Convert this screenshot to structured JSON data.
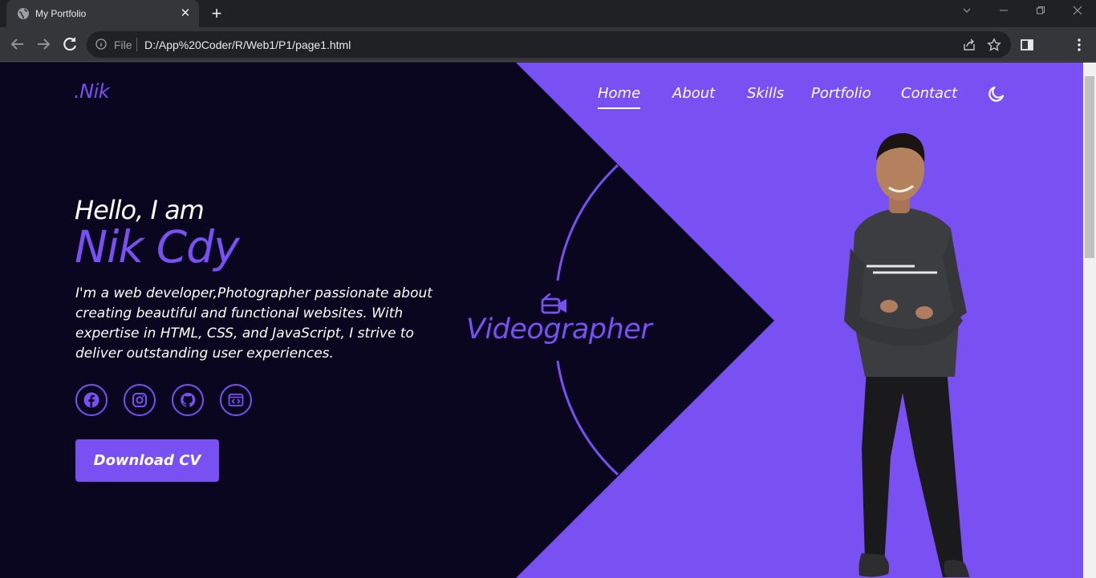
{
  "browser": {
    "tab_title": "My Portfolio",
    "omnibox_scheme": "File",
    "url": "D:/App%20Coder/R/Web1/P1/page1.html"
  },
  "site": {
    "logo": ".Nik",
    "nav": [
      {
        "label": "Home",
        "active": true
      },
      {
        "label": "About",
        "active": false
      },
      {
        "label": "Skills",
        "active": false
      },
      {
        "label": "Portfolio",
        "active": false
      },
      {
        "label": "Contact",
        "active": false
      }
    ],
    "theme_toggle_icon": "moon-icon"
  },
  "hero": {
    "greeting": "Hello, I am",
    "name": "Nik Cdy",
    "description": "I'm a web developer,Photographer passionate about creating beautiful and functional websites. With expertise in HTML, CSS, and JavaScript, I strive to deliver outstanding user experiences.",
    "socials": [
      "facebook-icon",
      "instagram-icon",
      "github-icon",
      "code-window-icon"
    ],
    "cta_label": "Download CV",
    "role_icon": "video-camera-icon",
    "role": "Videographer"
  },
  "colors": {
    "accent": "#7950f2",
    "background": "#0a0620",
    "text": "#ffffff"
  }
}
